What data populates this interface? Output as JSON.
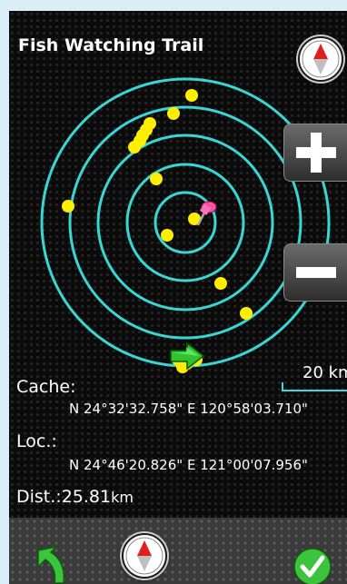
{
  "header": {
    "title": "Fish Watching Trail",
    "compass_icon": "compass-icon"
  },
  "zoom": {
    "in_icon": "plus-icon",
    "out_icon": "minus-icon"
  },
  "map": {
    "ring_color": "#3ad6d4",
    "point_color": "#ffee00",
    "scale_label": "20 km",
    "target_icon": "pushpin-icon",
    "heading_icon": "green-arrow-icon"
  },
  "info": {
    "cache_label": "Cache:",
    "cache_coords": "N  24°32'32.758\"  E 120°58'03.710\"",
    "loc_label": "Loc.:",
    "loc_coords": "N  24°46'20.826\"  E 121°00'07.956\"",
    "dist_label": "Dist.:",
    "dist_value": "25.81",
    "dist_unit": "km"
  },
  "toolbar": {
    "back_icon": "back-arrow-icon",
    "compass_icon": "compass-icon",
    "ok_icon": "checkmark-icon"
  }
}
